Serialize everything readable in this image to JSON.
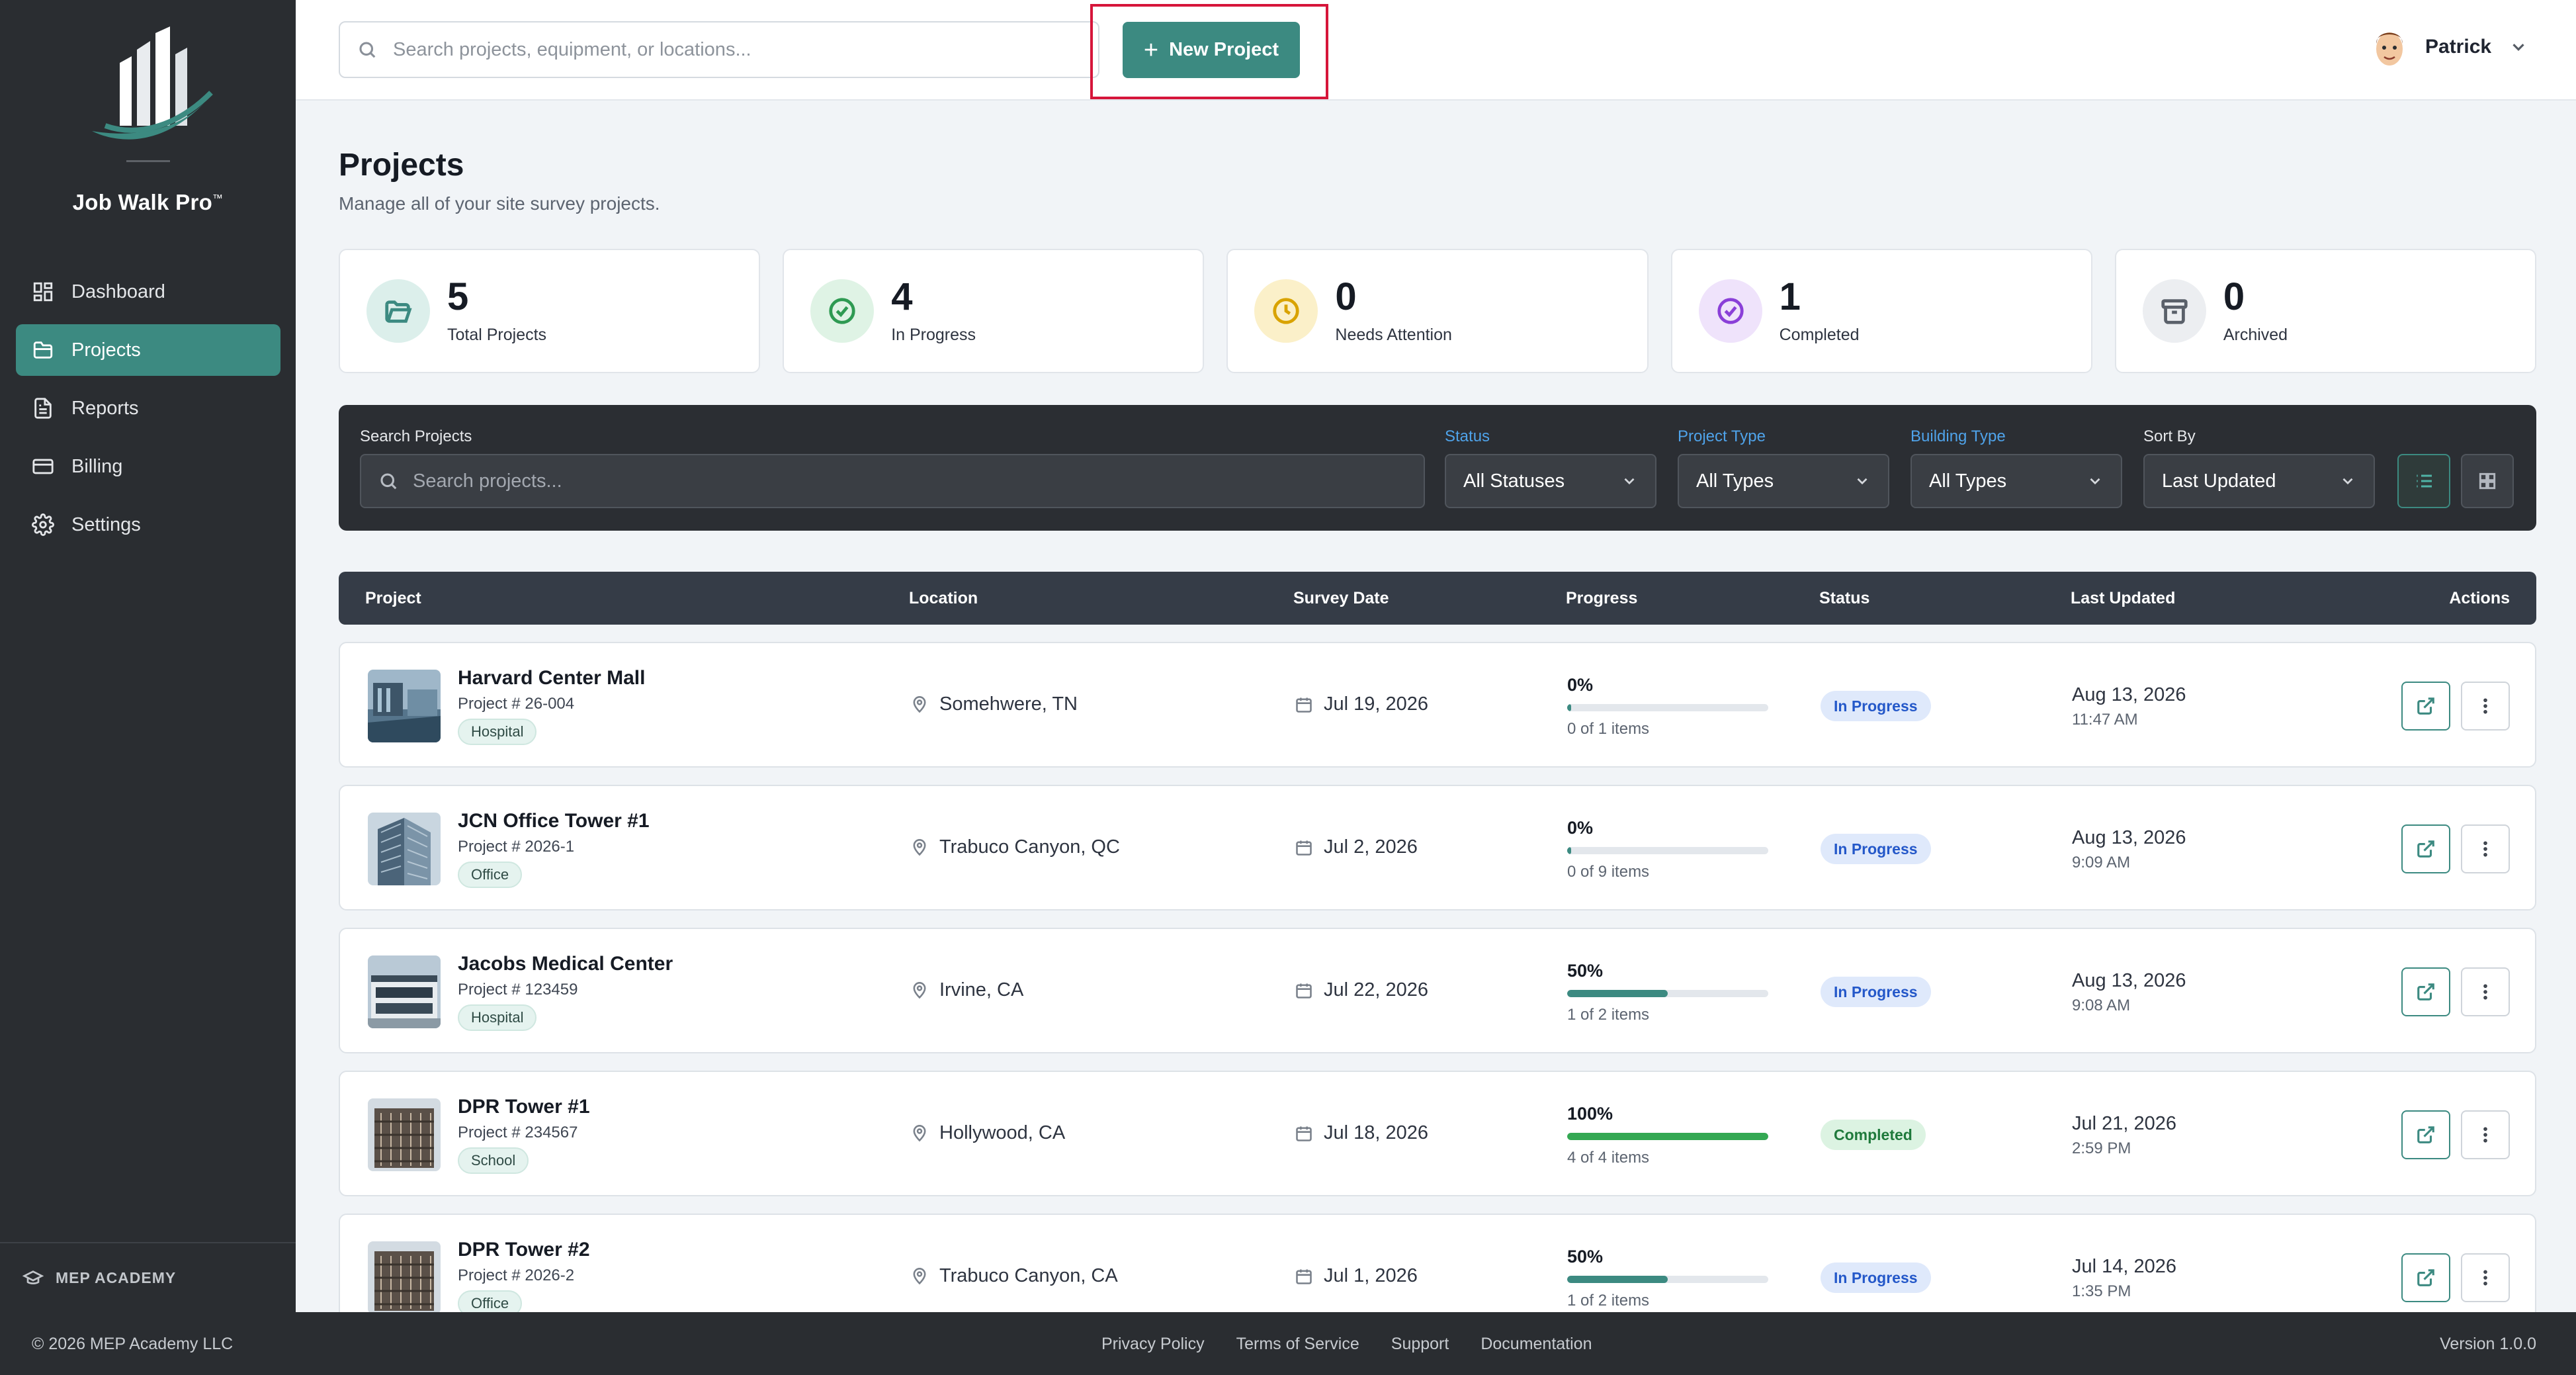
{
  "app": {
    "brand": "Job Walk Pro",
    "trademark": "™"
  },
  "sidebar": {
    "items": [
      {
        "label": "Dashboard",
        "icon": "dashboard-icon"
      },
      {
        "label": "Projects",
        "icon": "folder-icon",
        "active": true
      },
      {
        "label": "Reports",
        "icon": "document-icon"
      },
      {
        "label": "Billing",
        "icon": "credit-card-icon"
      },
      {
        "label": "Settings",
        "icon": "gear-icon"
      }
    ],
    "footer_label": "MEP ACADEMY"
  },
  "topbar": {
    "search_placeholder": "Search projects, equipment, or locations...",
    "new_project_label": "New Project",
    "user_name": "Patrick"
  },
  "header": {
    "title": "Projects",
    "subtitle": "Manage all of your site survey projects."
  },
  "stats": [
    {
      "value": "5",
      "label": "Total Projects",
      "icon": "folder-open-icon",
      "color": "#3c8a81",
      "bg": "#dcefeb"
    },
    {
      "value": "4",
      "label": "In Progress",
      "icon": "check-circle-icon",
      "color": "#2e9a52",
      "bg": "#dff3e5"
    },
    {
      "value": "0",
      "label": "Needs Attention",
      "icon": "clock-icon",
      "color": "#d9a300",
      "bg": "#fbf0c9"
    },
    {
      "value": "1",
      "label": "Completed",
      "icon": "check-circle-icon",
      "color": "#8a3fd8",
      "bg": "#efe3fb"
    },
    {
      "value": "0",
      "label": "Archived",
      "icon": "archive-icon",
      "color": "#5a606a",
      "bg": "#eceef1"
    }
  ],
  "filters": {
    "search_label": "Search Projects",
    "search_placeholder": "Search projects...",
    "status_label": "Status",
    "status_value": "All Statuses",
    "project_type_label": "Project Type",
    "project_type_value": "All Types",
    "building_type_label": "Building Type",
    "building_type_value": "All Types",
    "sort_label": "Sort By",
    "sort_value": "Last Updated"
  },
  "table": {
    "columns": [
      "Project",
      "Location",
      "Survey Date",
      "Progress",
      "Status",
      "Last Updated",
      "Actions"
    ],
    "rows": [
      {
        "name": "Harvard Center Mall",
        "number": "Project # 26-004",
        "tag": "Hospital",
        "location": "Somehwere, TN",
        "survey_date": "Jul 19, 2026",
        "progress_pct": "0%",
        "progress": 0,
        "items": "0 of 1 items",
        "status": "In Progress",
        "updated_date": "Aug 13, 2026",
        "updated_time": "11:47 AM"
      },
      {
        "name": "JCN Office Tower #1",
        "number": "Project # 2026-1",
        "tag": "Office",
        "location": "Trabuco Canyon, QC",
        "survey_date": "Jul 2, 2026",
        "progress_pct": "0%",
        "progress": 0,
        "items": "0 of 9 items",
        "status": "In Progress",
        "updated_date": "Aug 13, 2026",
        "updated_time": "9:09 AM"
      },
      {
        "name": "Jacobs Medical Center",
        "number": "Project # 123459",
        "tag": "Hospital",
        "location": "Irvine, CA",
        "survey_date": "Jul 22, 2026",
        "progress_pct": "50%",
        "progress": 50,
        "items": "1 of 2 items",
        "status": "In Progress",
        "updated_date": "Aug 13, 2026",
        "updated_time": "9:08 AM"
      },
      {
        "name": "DPR Tower #1",
        "number": "Project # 234567",
        "tag": "School",
        "location": "Hollywood, CA",
        "survey_date": "Jul 18, 2026",
        "progress_pct": "100%",
        "progress": 100,
        "items": "4 of 4 items",
        "status": "Completed",
        "updated_date": "Jul 21, 2026",
        "updated_time": "2:59 PM"
      },
      {
        "name": "DPR Tower #2",
        "number": "Project # 2026-2",
        "tag": "Office",
        "location": "Trabuco Canyon, CA",
        "survey_date": "Jul 1, 2026",
        "progress_pct": "50%",
        "progress": 50,
        "items": "1 of 2 items",
        "status": "In Progress",
        "updated_date": "Jul 14, 2026",
        "updated_time": "1:35 PM"
      }
    ]
  },
  "colors": {
    "accent": "#3c8a81",
    "in_progress_bg": "#dfe9fb",
    "in_progress_text": "#2458c9",
    "completed_bg": "#dcf3e2",
    "completed_text": "#1f7a3c",
    "complete_bar": "#34a853"
  },
  "footer": {
    "copyright": "© 2026 MEP Academy LLC",
    "links": [
      "Privacy Policy",
      "Terms of Service",
      "Support",
      "Documentation"
    ],
    "version": "Version 1.0.0"
  }
}
